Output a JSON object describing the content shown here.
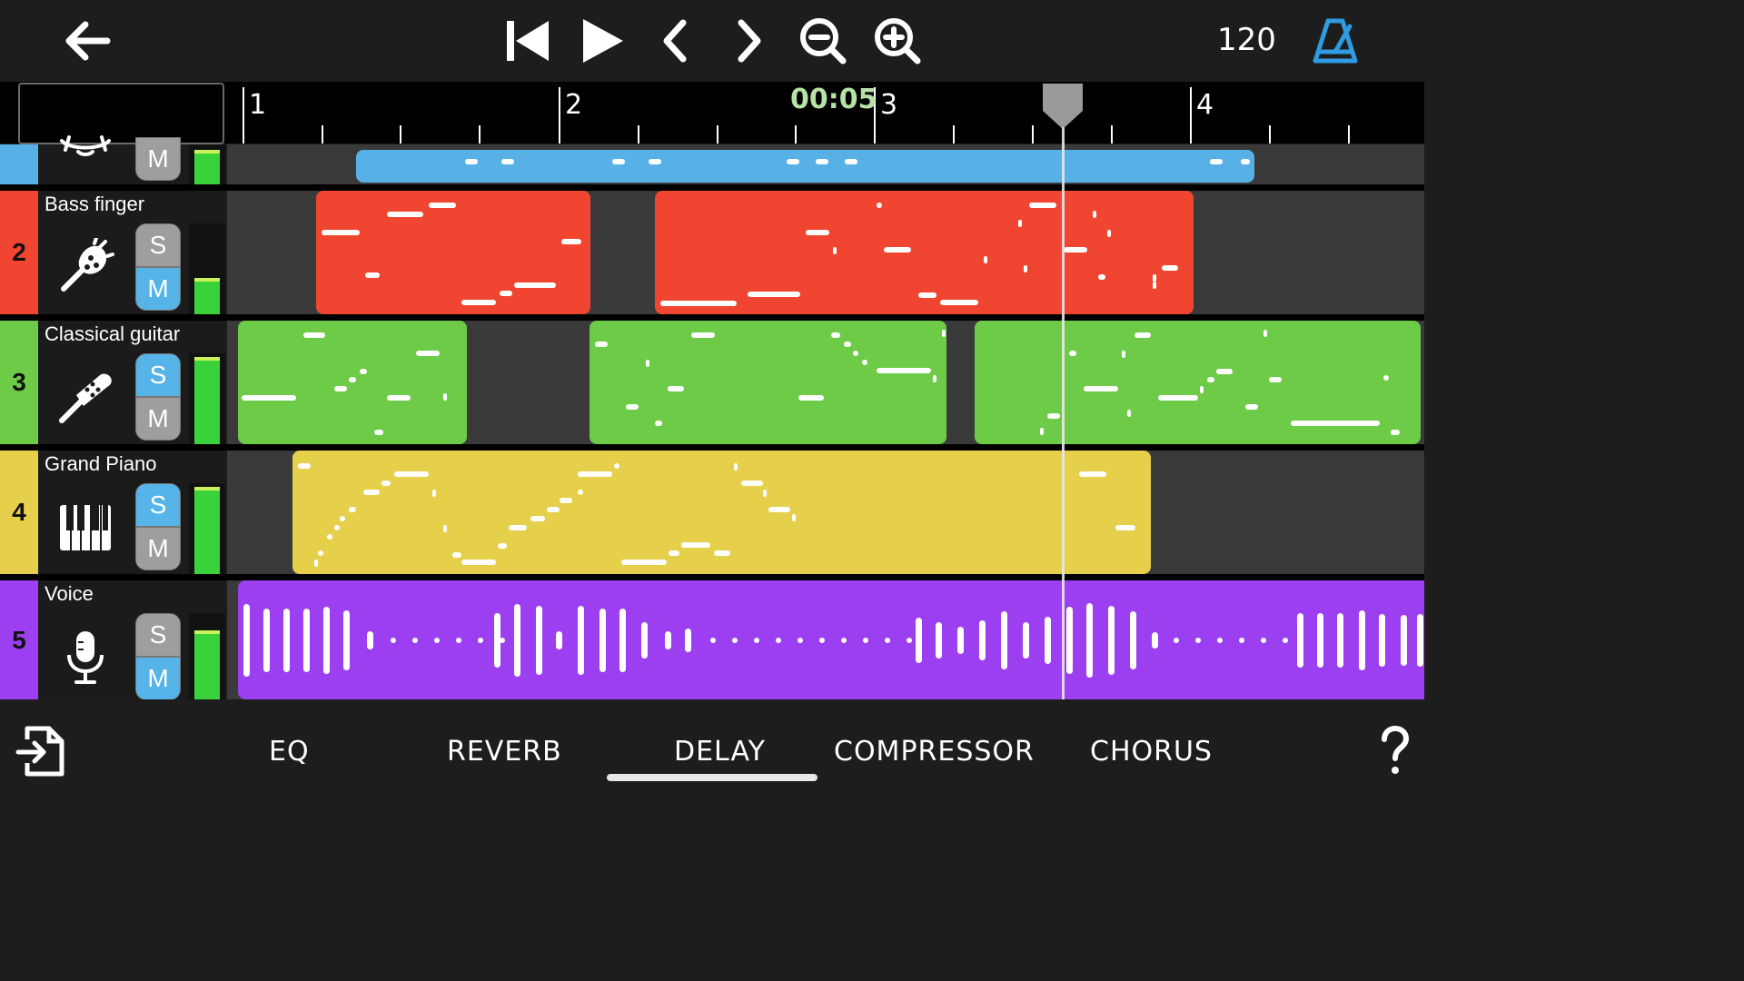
{
  "toolbar": {
    "tempo": "120"
  },
  "timeline": {
    "time": "00:05",
    "bars": [
      "1",
      "2",
      "3",
      "4"
    ]
  },
  "tracks": [
    {
      "number": "",
      "name": "",
      "solo_label": "",
      "mute_label": "M",
      "color": "#58b1e6",
      "icon": "drum-icon"
    },
    {
      "number": "2",
      "name": "Bass finger",
      "solo_label": "S",
      "mute_label": "M",
      "color": "#f04530",
      "icon": "bass-guitar-icon"
    },
    {
      "number": "3",
      "name": "Classical guitar",
      "solo_label": "S",
      "mute_label": "M",
      "color": "#6ecb48",
      "icon": "guitar-icon"
    },
    {
      "number": "4",
      "name": "Grand Piano",
      "solo_label": "S",
      "mute_label": "M",
      "color": "#e5cf4b",
      "icon": "piano-icon"
    },
    {
      "number": "5",
      "name": "Voice",
      "solo_label": "S",
      "mute_label": "M",
      "color": "#9b3ff0",
      "icon": "microphone-icon"
    }
  ],
  "effects_tabs": [
    "EQ",
    "REVERB",
    "DELAY",
    "COMPRESSOR",
    "CHORUS"
  ],
  "active_tab": "DELAY",
  "colors": {
    "accent": "#2f9be0",
    "solo_active": "#56b4e8",
    "button_inactive": "#9e9e9e",
    "meter": "#3ad23a",
    "time": "#b6e2a6"
  }
}
